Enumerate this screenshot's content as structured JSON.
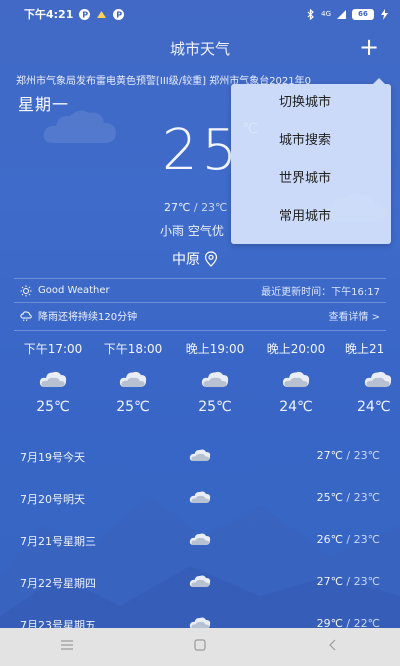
{
  "status_bar": {
    "time": "下午4:21",
    "network": "4G",
    "battery": "66"
  },
  "header": {
    "title": "城市天气",
    "add_icon": "plus-icon"
  },
  "alert_marquee": "郑州市气象局发布雷电黄色预警[III级/较重]   郑州市气象台2021年0",
  "current": {
    "weekday": "星期一",
    "temperature": "25",
    "unit": "℃",
    "high": "27℃",
    "separator": " / ",
    "low": "23℃",
    "condition": "小雨  空气优",
    "city": "中原"
  },
  "info": {
    "good_weather_label": "Good Weather",
    "update_time": "最近更新时间：下午16:17",
    "rain_notice": "降雨还将持续120分钟",
    "details_link": "查看详情 >"
  },
  "hourly": [
    {
      "time": "下午17:00",
      "temp": "25℃",
      "icon": "cloudy-icon"
    },
    {
      "time": "下午18:00",
      "temp": "25℃",
      "icon": "cloudy-icon"
    },
    {
      "time": "晚上19:00",
      "temp": "25℃",
      "icon": "cloudy-icon"
    },
    {
      "time": "晚上20:00",
      "temp": "24℃",
      "icon": "cloudy-icon"
    },
    {
      "time": "晚上21",
      "temp": "24℃",
      "icon": "cloudy-icon"
    }
  ],
  "daily": [
    {
      "date": "7月19号今天",
      "high": "27℃",
      "low": "23℃",
      "icon": "cloudy-icon"
    },
    {
      "date": "7月20号明天",
      "high": "25℃",
      "low": "23℃",
      "icon": "cloudy-icon"
    },
    {
      "date": "7月21号星期三",
      "high": "26℃",
      "low": "23℃",
      "icon": "cloudy-icon"
    },
    {
      "date": "7月22号星期四",
      "high": "27℃",
      "low": "23℃",
      "icon": "cloudy-icon"
    },
    {
      "date": "7月23号星期五",
      "high": "29℃",
      "low": "22℃",
      "icon": "cloudy-icon"
    }
  ],
  "menu": {
    "items": [
      "切换城市",
      "城市搜索",
      "世界城市",
      "常用城市"
    ]
  },
  "nav": {
    "menu_icon": "menu-icon",
    "home_icon": "home-icon",
    "back_icon": "back-icon"
  },
  "colors": {
    "background": "#3d66c4",
    "menu_bg": "#d6e4fc",
    "nav_bg": "#e3e3e3"
  }
}
